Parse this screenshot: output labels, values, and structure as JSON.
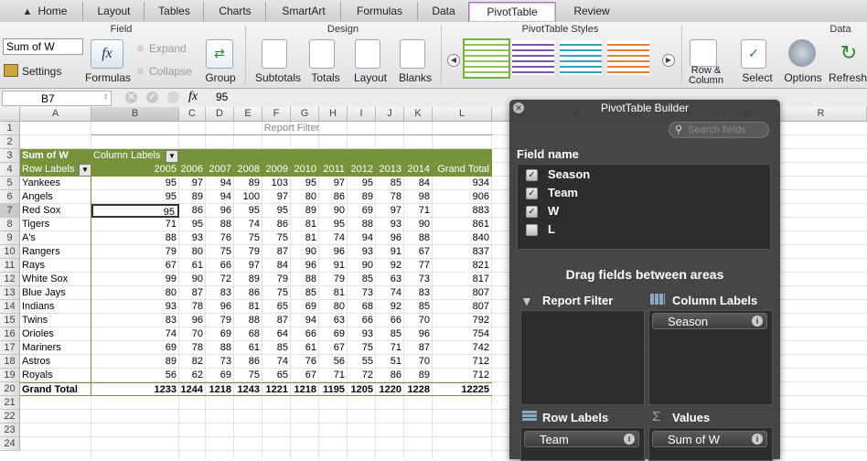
{
  "tabs": [
    "Home",
    "Layout",
    "Tables",
    "Charts",
    "SmartArt",
    "Formulas",
    "Data",
    "PivotTable",
    "Review"
  ],
  "active_tab": "PivotTable",
  "ribbon": {
    "groups": {
      "field": "Field",
      "design": "Design",
      "styles": "PivotTable Styles",
      "data": "Data"
    },
    "field_name_value": "Sum of W",
    "settings": "Settings",
    "formulas": "Formulas",
    "expand": "Expand",
    "collapse": "Collapse",
    "group": "Group",
    "subtotals": "Subtotals",
    "totals": "Totals",
    "layout": "Layout",
    "blanks": "Blanks",
    "row_column": "Row &\nColumn",
    "select": "Select",
    "options": "Options",
    "refresh": "Refresh"
  },
  "formula_bar": {
    "cell_ref": "B7",
    "fx": "fx",
    "value": "95"
  },
  "columns": [
    "A",
    "B",
    "C",
    "D",
    "E",
    "F",
    "G",
    "H",
    "I",
    "J",
    "K",
    "L",
    "M",
    "N",
    "O",
    "P",
    "Q",
    "R"
  ],
  "row_numbers": [
    "1",
    "2",
    "3",
    "4",
    "5",
    "6",
    "7",
    "8",
    "9",
    "10",
    "11",
    "12",
    "13",
    "14",
    "15",
    "16",
    "17",
    "18",
    "19",
    "20",
    "21",
    "22",
    "23",
    "24"
  ],
  "pivot": {
    "report_filter": "Report Filter",
    "sum_label": "Sum of W",
    "column_labels": "Column Labels",
    "row_labels": "Row Labels",
    "years": [
      "2005",
      "2006",
      "2007",
      "2008",
      "2009",
      "2010",
      "2011",
      "2012",
      "2013",
      "2014"
    ],
    "grand_total_header": "Grand Total",
    "rows": [
      {
        "team": "Yankees",
        "v": [
          "95",
          "97",
          "94",
          "89",
          "103",
          "95",
          "97",
          "95",
          "85",
          "84"
        ],
        "total": "934"
      },
      {
        "team": "Angels",
        "v": [
          "95",
          "89",
          "94",
          "100",
          "97",
          "80",
          "86",
          "89",
          "78",
          "98"
        ],
        "total": "906"
      },
      {
        "team": "Red Sox",
        "v": [
          "95",
          "86",
          "96",
          "95",
          "95",
          "89",
          "90",
          "69",
          "97",
          "71"
        ],
        "total": "883"
      },
      {
        "team": "Tigers",
        "v": [
          "71",
          "95",
          "88",
          "74",
          "86",
          "81",
          "95",
          "88",
          "93",
          "90"
        ],
        "total": "861"
      },
      {
        "team": "A's",
        "v": [
          "88",
          "93",
          "76",
          "75",
          "75",
          "81",
          "74",
          "94",
          "96",
          "88"
        ],
        "total": "840"
      },
      {
        "team": "Rangers",
        "v": [
          "79",
          "80",
          "75",
          "79",
          "87",
          "90",
          "96",
          "93",
          "91",
          "67"
        ],
        "total": "837"
      },
      {
        "team": "Rays",
        "v": [
          "67",
          "61",
          "66",
          "97",
          "84",
          "96",
          "91",
          "90",
          "92",
          "77"
        ],
        "total": "821"
      },
      {
        "team": "White Sox",
        "v": [
          "99",
          "90",
          "72",
          "89",
          "79",
          "88",
          "79",
          "85",
          "63",
          "73"
        ],
        "total": "817"
      },
      {
        "team": "Blue Jays",
        "v": [
          "80",
          "87",
          "83",
          "86",
          "75",
          "85",
          "81",
          "73",
          "74",
          "83"
        ],
        "total": "807"
      },
      {
        "team": "Indians",
        "v": [
          "93",
          "78",
          "96",
          "81",
          "65",
          "69",
          "80",
          "68",
          "92",
          "85"
        ],
        "total": "807"
      },
      {
        "team": "Twins",
        "v": [
          "83",
          "96",
          "79",
          "88",
          "87",
          "94",
          "63",
          "66",
          "66",
          "70"
        ],
        "total": "792"
      },
      {
        "team": "Orioles",
        "v": [
          "74",
          "70",
          "69",
          "68",
          "64",
          "66",
          "69",
          "93",
          "85",
          "96"
        ],
        "total": "754"
      },
      {
        "team": "Mariners",
        "v": [
          "69",
          "78",
          "88",
          "61",
          "85",
          "61",
          "67",
          "75",
          "71",
          "87"
        ],
        "total": "742"
      },
      {
        "team": "Astros",
        "v": [
          "89",
          "82",
          "73",
          "86",
          "74",
          "76",
          "56",
          "55",
          "51",
          "70"
        ],
        "total": "712"
      },
      {
        "team": "Royals",
        "v": [
          "56",
          "62",
          "69",
          "75",
          "65",
          "67",
          "71",
          "72",
          "86",
          "89"
        ],
        "total": "712"
      }
    ],
    "grand_total_row": {
      "label": "Grand Total",
      "v": [
        "1233",
        "1244",
        "1218",
        "1243",
        "1221",
        "1218",
        "1195",
        "1205",
        "1220",
        "1228"
      ],
      "total": "12225"
    }
  },
  "builder": {
    "title": "PivotTable Builder",
    "search_placeholder": "Search fields",
    "field_name": "Field name",
    "fields": [
      {
        "name": "Season",
        "checked": true
      },
      {
        "name": "Team",
        "checked": true
      },
      {
        "name": "W",
        "checked": true
      },
      {
        "name": "L",
        "checked": false
      }
    ],
    "drag_text": "Drag fields between areas",
    "report_filter": "Report Filter",
    "column_labels": "Column Labels",
    "row_labels": "Row Labels",
    "values": "Values",
    "column_item": "Season",
    "row_item": "Team",
    "value_item": "Sum of W"
  },
  "colors": {
    "pivot_header_green": "#76933c",
    "tab_active_border": "#b070c8"
  }
}
